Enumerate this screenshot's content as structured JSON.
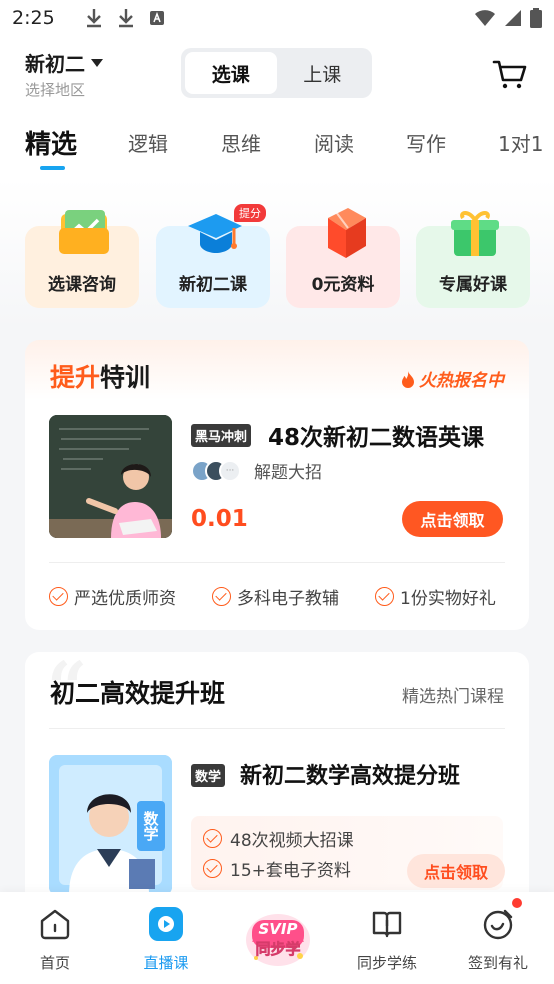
{
  "status_bar": {
    "time": "2:25"
  },
  "header": {
    "grade": "新初二",
    "region_hint": "选择地区",
    "segments": [
      "选课",
      "上课"
    ],
    "active_segment": "选课"
  },
  "category_tabs": [
    "精选",
    "逻辑",
    "思维",
    "阅读",
    "写作",
    "1对1"
  ],
  "quick_entries": [
    {
      "label": "选课咨询",
      "icon": "chart-folder-icon",
      "bg": "#fff1e2"
    },
    {
      "label": "新初二课",
      "icon": "graduation-cap-icon",
      "bg": "#e4f5ff",
      "badge": "提分"
    },
    {
      "label": "0元资料",
      "icon": "book-icon",
      "bg": "#ffe9e9"
    },
    {
      "label": "专属好课",
      "icon": "gift-icon",
      "bg": "#e6f8ec"
    }
  ],
  "promo": {
    "title_highlight": "提升",
    "title_rest": "特训",
    "hot_label": "火热报名中",
    "tag": "黑马冲刺",
    "course_title": "48次新初二数语英课",
    "subtitle": "解题大招",
    "price": "0.01",
    "claim_label": "点击领取",
    "perks": [
      "严选优质师资",
      "多科电子教辅",
      "1份实物好礼"
    ]
  },
  "class_section": {
    "title": "初二高效提升班",
    "more_label": "精选热门课程",
    "subject_tag": "数学",
    "thumb_tag": "数学",
    "course_title": "新初二数学高效提分班",
    "features": [
      "48次视频大招课",
      "15+套电子资料"
    ],
    "claim_label": "点击领取"
  },
  "bottom_nav": {
    "items": [
      {
        "label": "首页",
        "icon": "home-icon"
      },
      {
        "label": "直播课",
        "icon": "live-play-icon"
      },
      {
        "label": "",
        "icon": "svip-icon"
      },
      {
        "label": "同步学练",
        "icon": "study-book-icon"
      },
      {
        "label": "签到有礼",
        "icon": "checkin-icon"
      }
    ],
    "active": "直播课",
    "svip_text": "SVIP",
    "svip_sub": "同步学"
  },
  "colors": {
    "accent_blue": "#18a4f0",
    "accent_orange": "#ff5722"
  }
}
